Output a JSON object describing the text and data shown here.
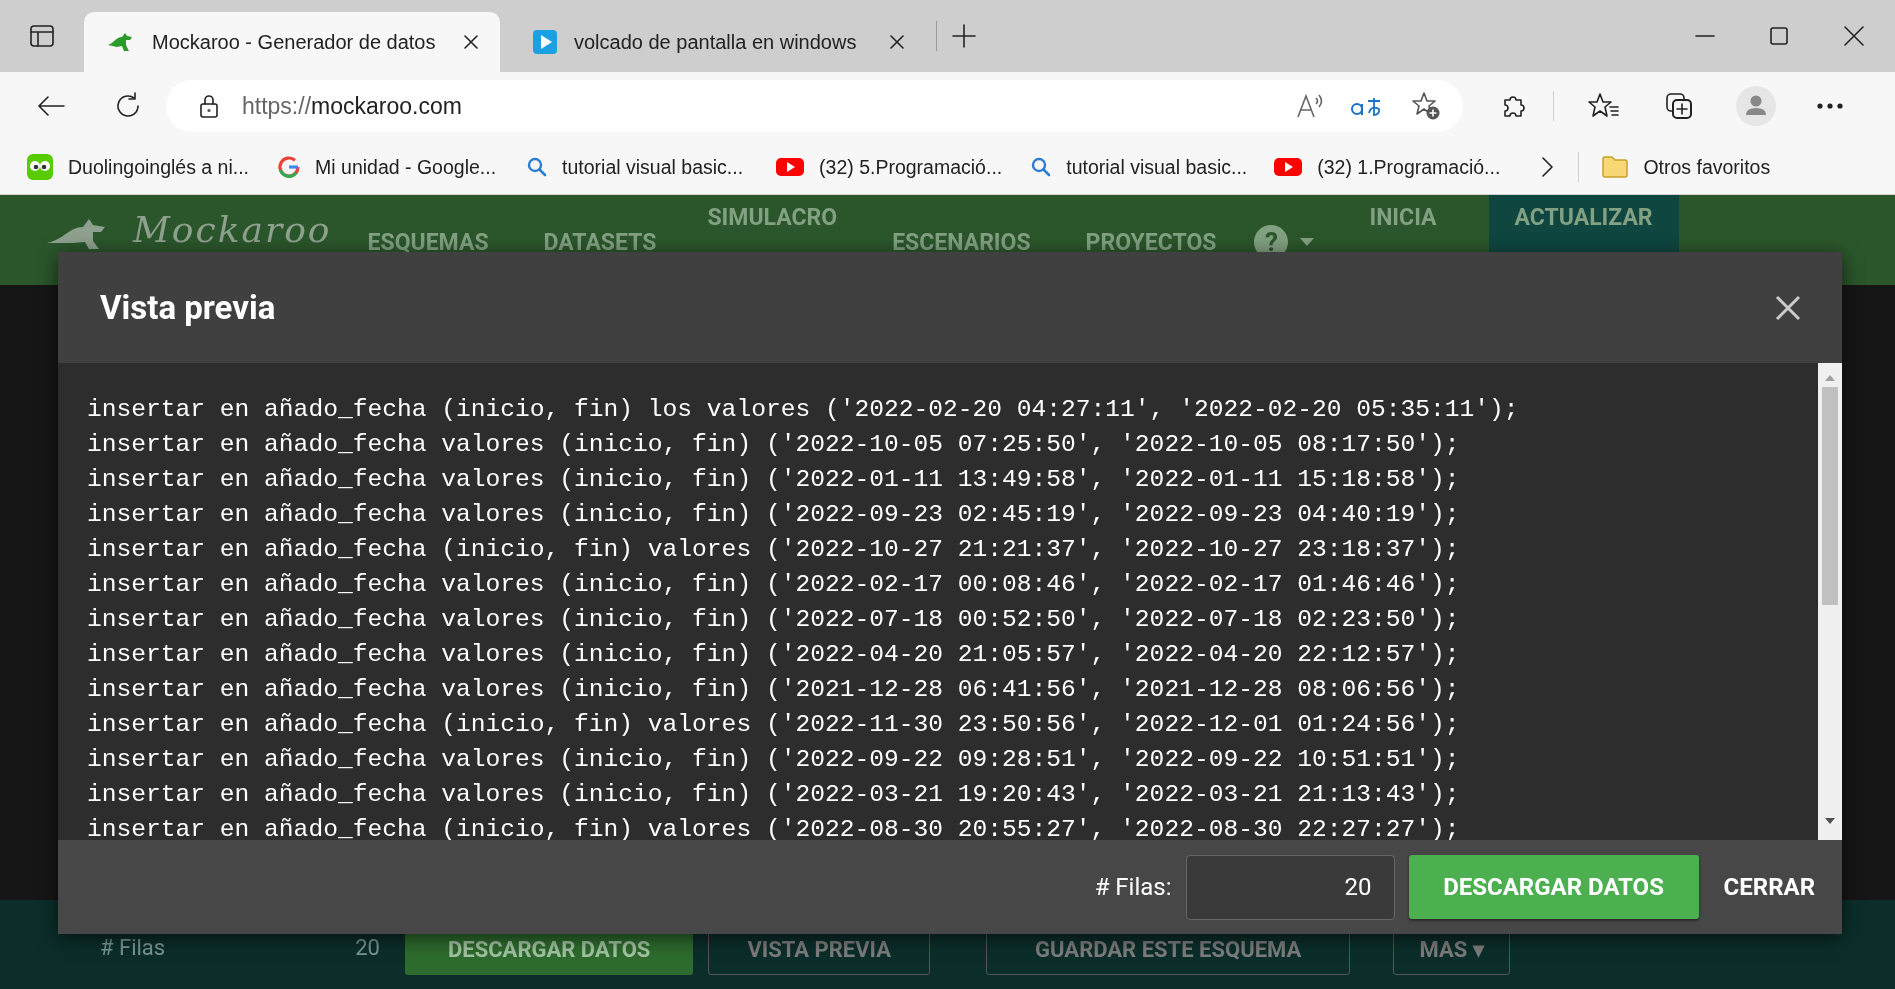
{
  "browser": {
    "tabs": [
      {
        "title": "Mockaroo - Generador de datos",
        "selected": true
      },
      {
        "title": "volcado de pantalla en windows",
        "selected": false
      }
    ],
    "url_scheme": "https://",
    "url_host": "mockaroo.com",
    "bookmarks": [
      {
        "label": "Duolingoinglés a ni...",
        "kind": "duolingo"
      },
      {
        "label": "Mi unidad - Google...",
        "kind": "google"
      },
      {
        "label": "tutorial visual basic...",
        "kind": "search"
      },
      {
        "label": "(32) 5.Programació...",
        "kind": "youtube"
      },
      {
        "label": "tutorial visual basic...",
        "kind": "search"
      },
      {
        "label": "(32) 1.Programació...",
        "kind": "youtube"
      }
    ],
    "other_favorites": "Otros favoritos"
  },
  "site": {
    "logo": "Mockaroo",
    "nav": [
      {
        "label": "ESQUEMAS",
        "kind": "link"
      },
      {
        "label": "DATASETS",
        "kind": "link"
      },
      {
        "label": "SIMULACRO",
        "kind": "top"
      },
      {
        "label": "ESCENARIOS",
        "kind": "link"
      },
      {
        "label": "PROYECTOS",
        "kind": "link"
      },
      {
        "label": "?",
        "kind": "help"
      },
      {
        "label": "INICIA",
        "kind": "top"
      },
      {
        "label": "ACTUALIZAR",
        "kind": "highlight"
      }
    ],
    "bottom_bar": {
      "rows_label": "# Filas",
      "rows_value": "20",
      "buttons": [
        {
          "label": "DESCARGAR DATOS",
          "kind": "primary"
        },
        {
          "label": "VISTA PREVIA",
          "kind": "outline"
        },
        {
          "label": "GUARDAR ESTE ESQUEMA",
          "kind": "outline"
        },
        {
          "label": "MAS ▾",
          "kind": "outline"
        }
      ]
    }
  },
  "modal": {
    "title": "Vista previa",
    "lines": [
      "insertar en añado_fecha (inicio, fin) los valores ('2022-02-20 04:27:11', '2022-02-20 05:35:11');",
      "insertar en añado_fecha valores (inicio, fin) ('2022-10-05 07:25:50', '2022-10-05 08:17:50');",
      "insertar en añado_fecha valores (inicio, fin) ('2022-01-11 13:49:58', '2022-01-11 15:18:58');",
      "insertar en añado_fecha valores (inicio, fin) ('2022-09-23 02:45:19', '2022-09-23 04:40:19');",
      "insertar en añado_fecha (inicio, fin) valores ('2022-10-27 21:21:37', '2022-10-27 23:18:37');",
      "insertar en añado_fecha valores (inicio, fin) ('2022-02-17 00:08:46', '2022-02-17 01:46:46');",
      "insertar en añado_fecha valores (inicio, fin) ('2022-07-18 00:52:50', '2022-07-18 02:23:50');",
      "insertar en añado_fecha valores (inicio, fin) ('2022-04-20 21:05:57', '2022-04-20 22:12:57');",
      "insertar en añado_fecha valores (inicio, fin) ('2021-12-28 06:41:56', '2021-12-28 08:06:56');",
      "insertar en añado_fecha (inicio, fin) valores ('2022-11-30 23:50:56', '2022-12-01 01:24:56');",
      "insertar en añado_fecha valores (inicio, fin) ('2022-09-22 09:28:51', '2022-09-22 10:51:51');",
      "insertar en añado_fecha valores (inicio, fin) ('2022-03-21 19:20:43', '2022-03-21 21:13:43');",
      "insertar en añado_fecha (inicio, fin) valores ('2022-08-30 20:55:27', '2022-08-30 22:27:27');"
    ],
    "rows_label": "# Filas:",
    "rows_value": "20",
    "download": "DESCARGAR DATOS",
    "close": "CERRAR"
  }
}
